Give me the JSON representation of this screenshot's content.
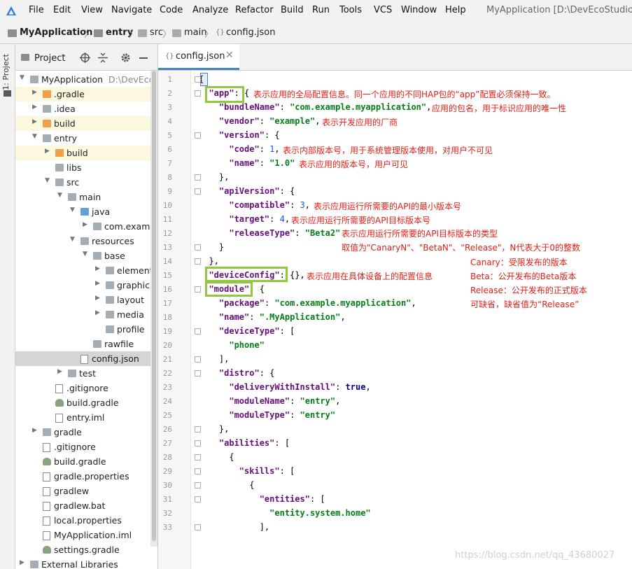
{
  "menu": {
    "items": [
      "File",
      "Edit",
      "View",
      "Navigate",
      "Code",
      "Analyze",
      "Refactor",
      "Build",
      "Run",
      "Tools",
      "VCS",
      "Window",
      "Help"
    ],
    "project_title": "MyApplication [D:\\DevEcoStudioPro"
  },
  "breadcrumb": [
    "MyApplication",
    "entry",
    "src",
    "main",
    "config.json"
  ],
  "stripe_label": "1: Project",
  "project_panel": {
    "title": "Project"
  },
  "tree": [
    {
      "label": "MyApplication",
      "hint": "D:\\DevEcoSt",
      "depth": 0,
      "expanded": true,
      "icon": "folder-gray"
    },
    {
      "label": ".gradle",
      "depth": 1,
      "expanded": false,
      "icon": "folder-orange",
      "highlight": true
    },
    {
      "label": ".idea",
      "depth": 1,
      "expanded": false,
      "icon": "folder-gray"
    },
    {
      "label": "build",
      "depth": 1,
      "expanded": false,
      "icon": "folder-orange",
      "highlight": true
    },
    {
      "label": "entry",
      "depth": 1,
      "expanded": true,
      "icon": "folder-module"
    },
    {
      "label": "build",
      "depth": 2,
      "expanded": false,
      "icon": "folder-orange",
      "highlight": true
    },
    {
      "label": "libs",
      "depth": 2,
      "icon": "folder-gray"
    },
    {
      "label": "src",
      "depth": 2,
      "expanded": true,
      "icon": "folder-gray"
    },
    {
      "label": "main",
      "depth": 3,
      "expanded": true,
      "icon": "folder-gray"
    },
    {
      "label": "java",
      "depth": 4,
      "expanded": true,
      "icon": "folder-blue"
    },
    {
      "label": "com.example",
      "depth": 5,
      "expanded": false,
      "icon": "folder-gray"
    },
    {
      "label": "resources",
      "depth": 4,
      "expanded": true,
      "icon": "folder-res"
    },
    {
      "label": "base",
      "depth": 5,
      "expanded": true,
      "icon": "folder-gray"
    },
    {
      "label": "element",
      "depth": 6,
      "expanded": false,
      "icon": "folder-gray"
    },
    {
      "label": "graphic",
      "depth": 6,
      "expanded": false,
      "icon": "folder-gray"
    },
    {
      "label": "layout",
      "depth": 6,
      "expanded": false,
      "icon": "folder-gray"
    },
    {
      "label": "media",
      "depth": 6,
      "expanded": false,
      "icon": "folder-gray"
    },
    {
      "label": "profile",
      "depth": 6,
      "icon": "folder-gray"
    },
    {
      "label": "rawfile",
      "depth": 5,
      "icon": "folder-gray"
    },
    {
      "label": "config.json",
      "depth": 4,
      "icon": "file-json",
      "selected": true
    },
    {
      "label": "test",
      "depth": 3,
      "expanded": false,
      "icon": "folder-gray"
    },
    {
      "label": ".gitignore",
      "depth": 2,
      "icon": "file-text"
    },
    {
      "label": "build.gradle",
      "depth": 2,
      "icon": "file-gradle"
    },
    {
      "label": "entry.iml",
      "depth": 2,
      "icon": "file-iml"
    },
    {
      "label": "gradle",
      "depth": 1,
      "expanded": false,
      "icon": "folder-gray"
    },
    {
      "label": ".gitignore",
      "depth": 1,
      "icon": "file-text"
    },
    {
      "label": "build.gradle",
      "depth": 1,
      "icon": "file-gradle"
    },
    {
      "label": "gradle.properties",
      "depth": 1,
      "icon": "file-props"
    },
    {
      "label": "gradlew",
      "depth": 1,
      "icon": "file-text"
    },
    {
      "label": "gradlew.bat",
      "depth": 1,
      "icon": "file-text"
    },
    {
      "label": "local.properties",
      "depth": 1,
      "icon": "file-props"
    },
    {
      "label": "MyApplication.iml",
      "depth": 1,
      "icon": "file-iml"
    },
    {
      "label": "settings.gradle",
      "depth": 1,
      "icon": "file-gradle"
    },
    {
      "label": "External Libraries",
      "depth": 0,
      "expanded": false,
      "icon": "lib"
    }
  ],
  "editor": {
    "tab_label": "config.json",
    "lines": [
      [
        [
          "p",
          "{"
        ]
      ],
      [
        [
          "p",
          "  "
        ],
        [
          "k",
          "\"app\""
        ],
        [
          "p",
          ": {"
        ]
      ],
      [
        [
          "p",
          "    "
        ],
        [
          "k",
          "\"bundleName\""
        ],
        [
          "p",
          ": "
        ],
        [
          "s",
          "\"com.example.myapplication\""
        ],
        [
          "p",
          ","
        ]
      ],
      [
        [
          "p",
          "    "
        ],
        [
          "k",
          "\"vendor\""
        ],
        [
          "p",
          ": "
        ],
        [
          "s",
          "\"example\""
        ],
        [
          "p",
          ","
        ]
      ],
      [
        [
          "p",
          "    "
        ],
        [
          "k",
          "\"version\""
        ],
        [
          "p",
          ": {"
        ]
      ],
      [
        [
          "p",
          "      "
        ],
        [
          "k",
          "\"code\""
        ],
        [
          "p",
          ": "
        ],
        [
          "n",
          "1"
        ],
        [
          "p",
          ","
        ]
      ],
      [
        [
          "p",
          "      "
        ],
        [
          "k",
          "\"name\""
        ],
        [
          "p",
          ": "
        ],
        [
          "s",
          "\"1.0\""
        ]
      ],
      [
        [
          "p",
          "    },"
        ]
      ],
      [
        [
          "p",
          "    "
        ],
        [
          "k",
          "\"apiVersion\""
        ],
        [
          "p",
          ": {"
        ]
      ],
      [
        [
          "p",
          "      "
        ],
        [
          "k",
          "\"compatible\""
        ],
        [
          "p",
          ": "
        ],
        [
          "n",
          "3"
        ],
        [
          "p",
          ","
        ]
      ],
      [
        [
          "p",
          "      "
        ],
        [
          "k",
          "\"target\""
        ],
        [
          "p",
          ": "
        ],
        [
          "n",
          "4"
        ],
        [
          "p",
          ","
        ]
      ],
      [
        [
          "p",
          "      "
        ],
        [
          "k",
          "\"releaseType\""
        ],
        [
          "p",
          ": "
        ],
        [
          "s",
          "\"Beta2\""
        ]
      ],
      [
        [
          "p",
          "    }"
        ]
      ],
      [
        [
          "p",
          "  },"
        ]
      ],
      [
        [
          "p",
          "  "
        ],
        [
          "k",
          "\"deviceConfig\""
        ],
        [
          "p",
          ": {},"
        ]
      ],
      [
        [
          "p",
          "  "
        ],
        [
          "k",
          "\"module\""
        ],
        [
          "p",
          ": {"
        ]
      ],
      [
        [
          "p",
          "    "
        ],
        [
          "k",
          "\"package\""
        ],
        [
          "p",
          ": "
        ],
        [
          "s",
          "\"com.example.myapplication\""
        ],
        [
          "p",
          ","
        ]
      ],
      [
        [
          "p",
          "    "
        ],
        [
          "k",
          "\"name\""
        ],
        [
          "p",
          ": "
        ],
        [
          "s",
          "\".MyApplication\""
        ],
        [
          "p",
          ","
        ]
      ],
      [
        [
          "p",
          "    "
        ],
        [
          "k",
          "\"deviceType\""
        ],
        [
          "p",
          ": ["
        ]
      ],
      [
        [
          "p",
          "      "
        ],
        [
          "s",
          "\"phone\""
        ]
      ],
      [
        [
          "p",
          "    ],"
        ]
      ],
      [
        [
          "p",
          "    "
        ],
        [
          "k",
          "\"distro\""
        ],
        [
          "p",
          ": {"
        ]
      ],
      [
        [
          "p",
          "      "
        ],
        [
          "k",
          "\"deliveryWithInstall\""
        ],
        [
          "p",
          ": "
        ],
        [
          "b",
          "true"
        ],
        [
          "p",
          ","
        ]
      ],
      [
        [
          "p",
          "      "
        ],
        [
          "k",
          "\"moduleName\""
        ],
        [
          "p",
          ": "
        ],
        [
          "s",
          "\"entry\""
        ],
        [
          "p",
          ","
        ]
      ],
      [
        [
          "p",
          "      "
        ],
        [
          "k",
          "\"moduleType\""
        ],
        [
          "p",
          ": "
        ],
        [
          "s",
          "\"entry\""
        ]
      ],
      [
        [
          "p",
          "    },"
        ]
      ],
      [
        [
          "p",
          "    "
        ],
        [
          "k",
          "\"abilities\""
        ],
        [
          "p",
          ": ["
        ]
      ],
      [
        [
          "p",
          "      {"
        ]
      ],
      [
        [
          "p",
          "        "
        ],
        [
          "k",
          "\"skills\""
        ],
        [
          "p",
          ": ["
        ]
      ],
      [
        [
          "p",
          "          {"
        ]
      ],
      [
        [
          "p",
          "            "
        ],
        [
          "k",
          "\"entities\""
        ],
        [
          "p",
          ": ["
        ]
      ],
      [
        [
          "p",
          "              "
        ],
        [
          "s",
          "\"entity.system.home\""
        ]
      ],
      [
        [
          "p",
          "            ],"
        ]
      ]
    ]
  },
  "annotations": {
    "app": "表示应用的全局配置信息。同一个应用的不同HAP包的“app”配置必须保持一致。",
    "bundleName": "应用的包名，用于标识应用的唯一性",
    "vendor": "表示开发应用的厂商",
    "code": "表示内部版本号，用于系统管理版本使用，对用户不可见",
    "name": "表示应用的版本号，用户可见",
    "compatible": "表示应用运行所需要的API的最小版本号",
    "target": "表示应用运行所需要的API目标版本号",
    "releaseType": "表示应用运行所需要的API目标版本的类型",
    "releaseValues": "取值为\"CanaryN\"、\"BetaN\"、\"Release\"，N代表大于0的整数",
    "canary": "Canary：受限发布的版本",
    "beta": "Beta：公开发布的Beta版本",
    "release": "Release：公开发布的正式版本",
    "default": "可缺省，缺省值为“Release”",
    "deviceConfig": "表示应用在具体设备上的配置信息"
  },
  "watermark": "https://blog.csdn.net/qq_43680027"
}
